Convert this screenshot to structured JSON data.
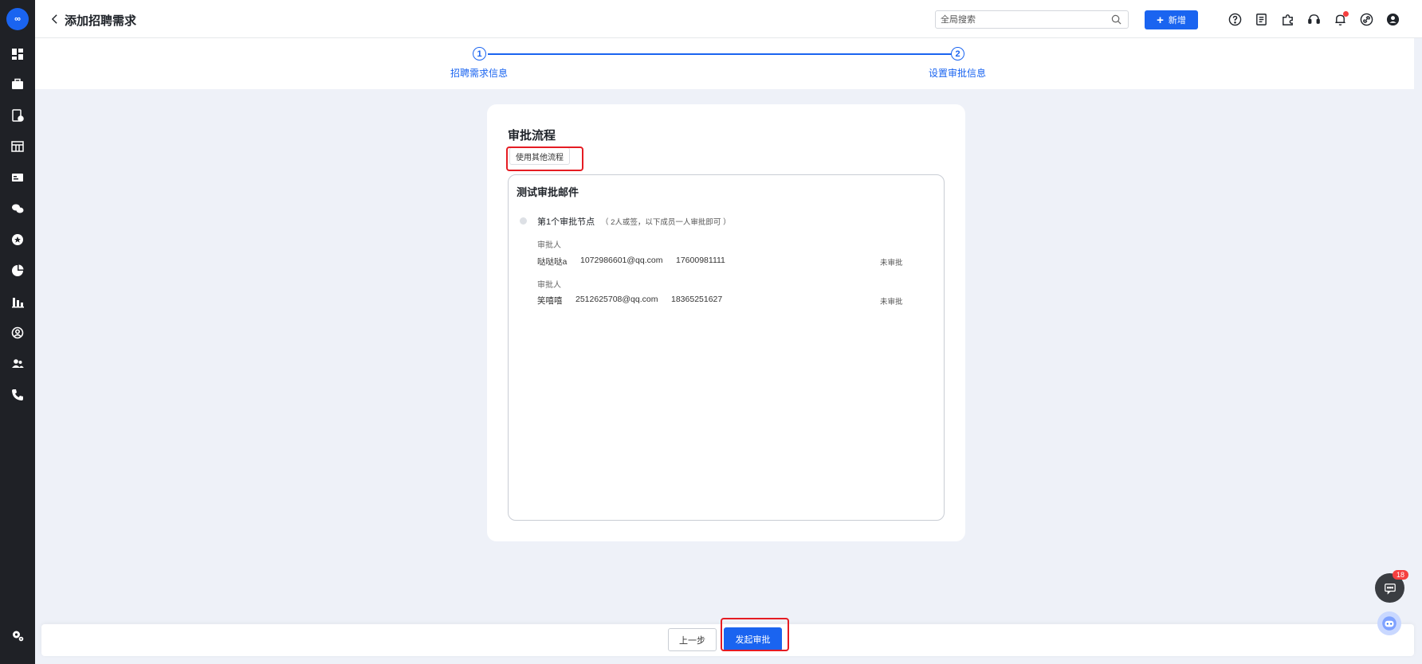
{
  "app": {
    "logo_text": "∞"
  },
  "sidebar": {
    "icons": [
      "dashboard-icon",
      "briefcase-icon",
      "document-check-icon",
      "calendar-table-icon",
      "id-card-icon",
      "wechat-icon",
      "star-circle-icon",
      "pie-chart-icon",
      "bar-chart-icon",
      "user-circle-icon",
      "users-icon",
      "phone-icon",
      "settings-icon"
    ]
  },
  "header": {
    "title": "添加招聘需求",
    "search_placeholder": "全局搜索",
    "new_label": "新增",
    "tool_icons": [
      "help-icon",
      "notes-icon",
      "puzzle-icon",
      "headset-icon",
      "bell-icon",
      "link-icon",
      "account-icon"
    ]
  },
  "steps": [
    {
      "num": "1",
      "label": "招聘需求信息"
    },
    {
      "num": "2",
      "label": "设置审批信息"
    }
  ],
  "approval": {
    "section_title": "审批流程",
    "use_other_label": "使用其他流程",
    "flow_name": "测试审批邮件",
    "node": {
      "title": "第1个审批节点",
      "note": "（ 2人或签，以下成员一人审批即可 ）"
    },
    "approvers": [
      {
        "role": "审批人",
        "name": "哒哒哒a",
        "email": "1072986601@qq.com",
        "phone": "17600981111",
        "status": "未审批"
      },
      {
        "role": "审批人",
        "name": "笑嘻嘻",
        "email": "2512625708@qq.com",
        "phone": "18365251627",
        "status": "未审批"
      }
    ]
  },
  "footer": {
    "prev_label": "上一步",
    "submit_label": "发起审批"
  },
  "chat": {
    "badge_count": "18"
  },
  "colors": {
    "primary": "#1a64f0",
    "highlight": "#e51c23",
    "sidebar": "#1f2126"
  }
}
